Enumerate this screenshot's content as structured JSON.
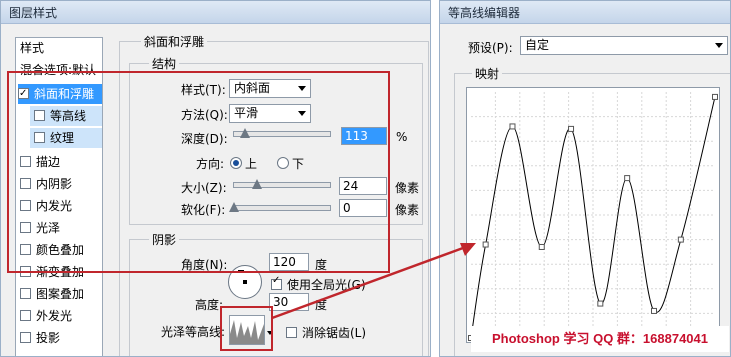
{
  "layer_style": {
    "title": "图层样式",
    "sidebar_header": "样式",
    "sidebar_items": [
      {
        "label": "混合选项:默认",
        "checkbox": false
      },
      {
        "label": "斜面和浮雕",
        "checkbox": true,
        "checked": true,
        "selected": true
      },
      {
        "label": "等高线",
        "checkbox": true,
        "checked": false,
        "sub": true
      },
      {
        "label": "纹理",
        "checkbox": true,
        "checked": false,
        "sub": true
      },
      {
        "label": "描边",
        "checkbox": true,
        "checked": false
      },
      {
        "label": "内阴影",
        "checkbox": true,
        "checked": false
      },
      {
        "label": "内发光",
        "checkbox": true,
        "checked": false
      },
      {
        "label": "光泽",
        "checkbox": true,
        "checked": false
      },
      {
        "label": "颜色叠加",
        "checkbox": true,
        "checked": false
      },
      {
        "label": "渐变叠加",
        "checkbox": true,
        "checked": false
      },
      {
        "label": "图案叠加",
        "checkbox": true,
        "checked": false
      },
      {
        "label": "外发光",
        "checkbox": true,
        "checked": false
      },
      {
        "label": "投影",
        "checkbox": true,
        "checked": false
      }
    ],
    "section_title": "斜面和浮雕",
    "structure": {
      "title": "结构",
      "style_label": "样式(T):",
      "style_value": "内斜面",
      "technique_label": "方法(Q):",
      "technique_value": "平滑",
      "depth_label": "深度(D):",
      "depth_value": "113",
      "depth_unit": "%",
      "depth_level": 0.113,
      "direction_label": "方向:",
      "dir_up": "上",
      "dir_down": "下",
      "direction_selected": "up",
      "size_label": "大小(Z):",
      "size_value": "24",
      "size_unit": "像素",
      "size_level": 0.24,
      "soften_label": "软化(F):",
      "soften_value": "0",
      "soften_unit": "像素",
      "soften_level": 0.0
    },
    "shading": {
      "title": "阴影",
      "angle_label": "角度(N):",
      "angle_value": "120",
      "angle_unit": "度",
      "global_light_label": "使用全局光(G)",
      "global_light_checked": true,
      "altitude_label": "高度:",
      "altitude_value": "30",
      "altitude_unit": "度",
      "gloss_contour_label": "光泽等高线:",
      "anti_alias_label": "消除锯齿(L)",
      "anti_alias_checked": false
    }
  },
  "contour_editor": {
    "title": "等高线编辑器",
    "preset_label": "预设(P):",
    "preset_value": "自定",
    "mapping_label": "映射"
  },
  "watermark": "Photoshop 学习 QQ 群：168874041",
  "colors": {
    "highlight_box": "#c0262c",
    "selection": "#3399ff",
    "sub_selection": "#cde4fa",
    "watermark_text": "#c8102e"
  },
  "contour_points": [
    [
      0,
      0
    ],
    [
      0.06,
      0.38
    ],
    [
      0.17,
      0.86
    ],
    [
      0.29,
      0.37
    ],
    [
      0.41,
      0.85
    ],
    [
      0.53,
      0.14
    ],
    [
      0.64,
      0.65
    ],
    [
      0.75,
      0.11
    ],
    [
      0.86,
      0.4
    ],
    [
      1,
      0.98
    ]
  ]
}
